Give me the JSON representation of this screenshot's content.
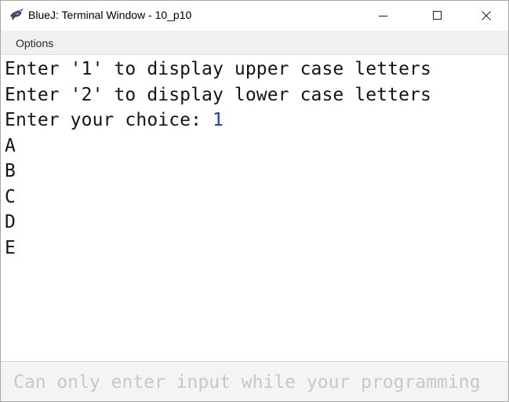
{
  "window": {
    "title": "BlueJ: Terminal Window - 10_p10",
    "app_icon": "bluej-bird-icon",
    "controls": [
      "minimize-icon",
      "maximize-icon",
      "close-icon"
    ]
  },
  "menubar": {
    "items": [
      {
        "label": "Options"
      }
    ]
  },
  "terminal": {
    "lines": [
      {
        "text": "Enter '1' to display upper case letters",
        "input": ""
      },
      {
        "text": "Enter '2' to display lower case letters",
        "input": ""
      },
      {
        "text": "Enter your choice: ",
        "input": "1"
      },
      {
        "text": "A",
        "input": ""
      },
      {
        "text": "B",
        "input": ""
      },
      {
        "text": "C",
        "input": ""
      },
      {
        "text": "D",
        "input": ""
      },
      {
        "text": "E",
        "input": ""
      }
    ],
    "text_color": "#141414",
    "input_color": "#1f3ea3"
  },
  "input_area": {
    "value": "",
    "placeholder": "Can only enter input while your programming"
  }
}
